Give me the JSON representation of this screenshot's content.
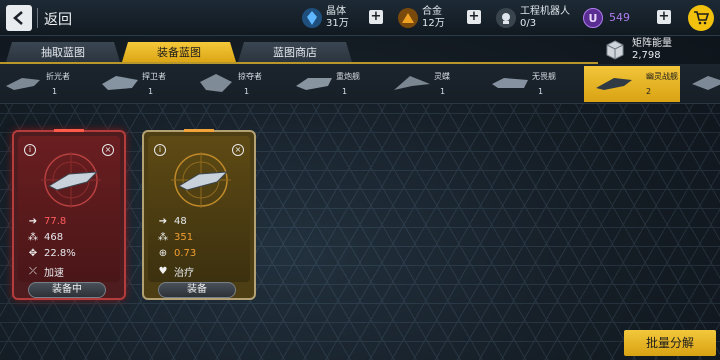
{
  "header": {
    "back_label": "返回",
    "resources": [
      {
        "name": "晶体",
        "value": "31万",
        "icon": "crystal-icon",
        "color": "#3a8fd6"
      },
      {
        "name": "合金",
        "value": "12万",
        "icon": "alloy-icon",
        "color": "#e79a1c"
      },
      {
        "name": "工程机器人",
        "value": "0/3",
        "icon": "robot-icon",
        "color": "#cfd6dc"
      }
    ],
    "premium": {
      "value": "549",
      "icon": "u-coin-icon",
      "color": "#8e4fd6",
      "letter": "U"
    },
    "cart_icon": "cart-icon"
  },
  "tabs": [
    {
      "label": "抽取蓝图",
      "active": false
    },
    {
      "label": "装备蓝图",
      "active": true
    },
    {
      "label": "蓝图商店",
      "active": false
    }
  ],
  "matrix_energy": {
    "label": "矩阵能量",
    "value": "2,798"
  },
  "ships": [
    {
      "name": "折光者",
      "count": "1"
    },
    {
      "name": "捍卫者",
      "count": "1"
    },
    {
      "name": "掠夺者",
      "count": "1"
    },
    {
      "name": "重炮舰",
      "count": "1"
    },
    {
      "name": "灵蝶",
      "count": "1"
    },
    {
      "name": "无畏舰",
      "count": "1"
    },
    {
      "name": "幽灵战舰",
      "count": "2",
      "active": true
    }
  ],
  "cards": [
    {
      "theme": "red",
      "stats": [
        {
          "icon": "arrow-icon",
          "value": "77.8",
          "color": "#ff5c5c"
        },
        {
          "icon": "cluster-icon",
          "value": "468",
          "color": "#e8e8e8"
        },
        {
          "icon": "missile-icon",
          "value": "22.8%",
          "color": "#e8e8e8"
        },
        {
          "icon": "boost-icon",
          "value": "加速",
          "color": "#e8e8e8"
        }
      ],
      "button": "装备中"
    },
    {
      "theme": "gold",
      "stats": [
        {
          "icon": "arrow-icon",
          "value": "48",
          "color": "#e8e8e8"
        },
        {
          "icon": "cluster-icon",
          "value": "351",
          "color": "#f0a030"
        },
        {
          "icon": "crosshair-icon",
          "value": "0.73",
          "color": "#f0a030"
        },
        {
          "icon": "heal-icon",
          "value": "治疗",
          "color": "#e8e8e8"
        }
      ],
      "button": "装备"
    }
  ],
  "bulk_button": "批量分解"
}
